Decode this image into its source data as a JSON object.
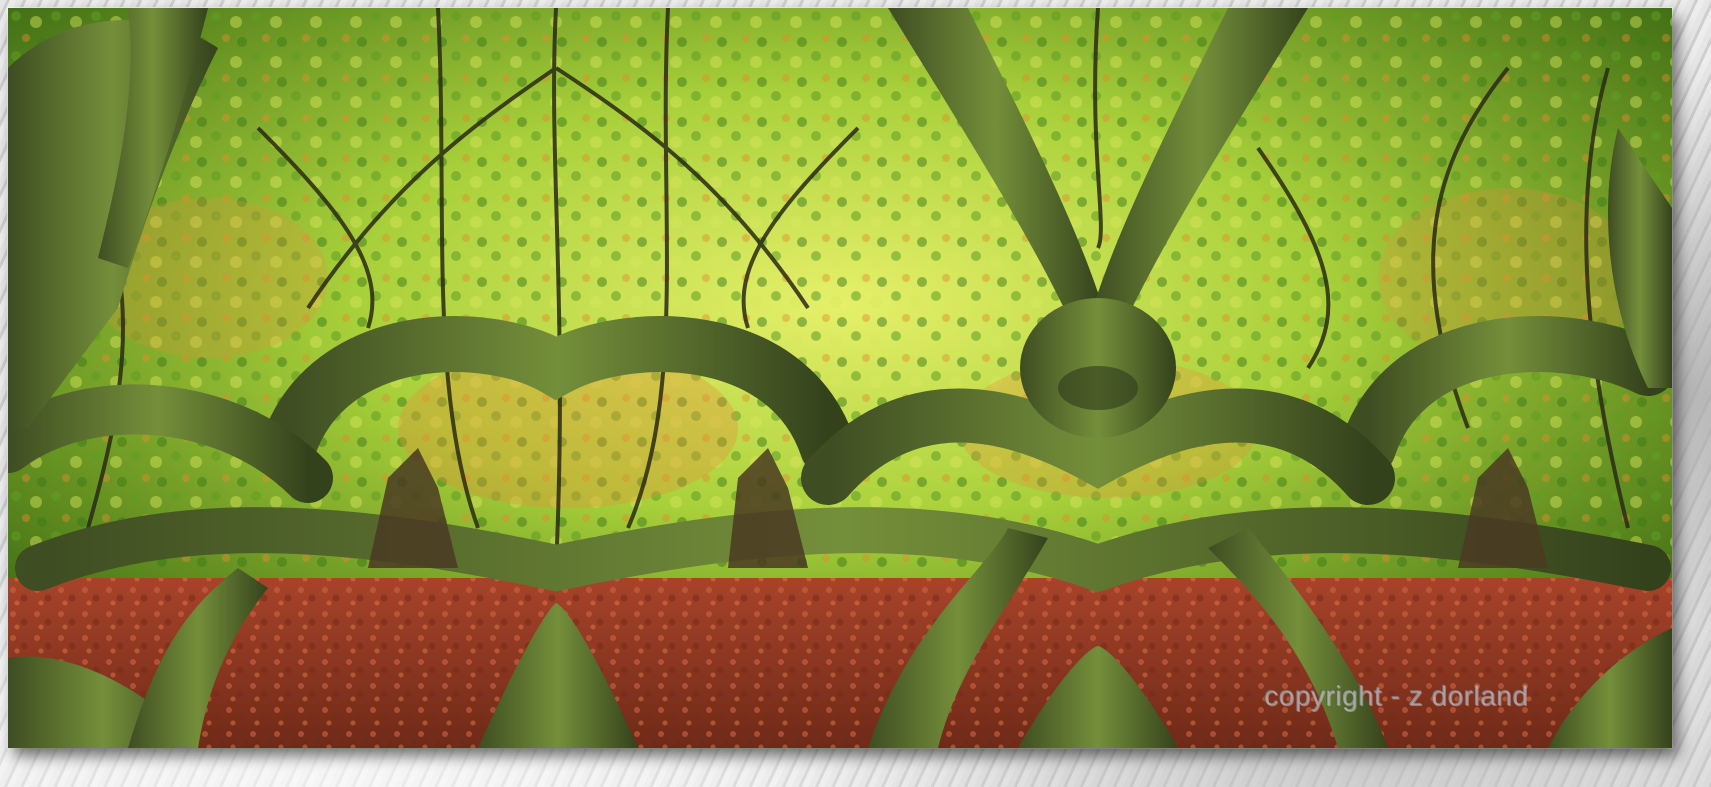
{
  "image": {
    "watermark": "copyright - z dorland",
    "colors": {
      "canopy_light": "#c8e24a",
      "canopy_mid": "#7fb52a",
      "canopy_dark": "#3f6d14",
      "orange_glow": "#e08a24",
      "trunk_moss": "#5f7a2e",
      "trunk_dark": "#2f3a1c",
      "leaf_litter": "#b8502a",
      "frame_bg": "#d9d9d9"
    }
  }
}
